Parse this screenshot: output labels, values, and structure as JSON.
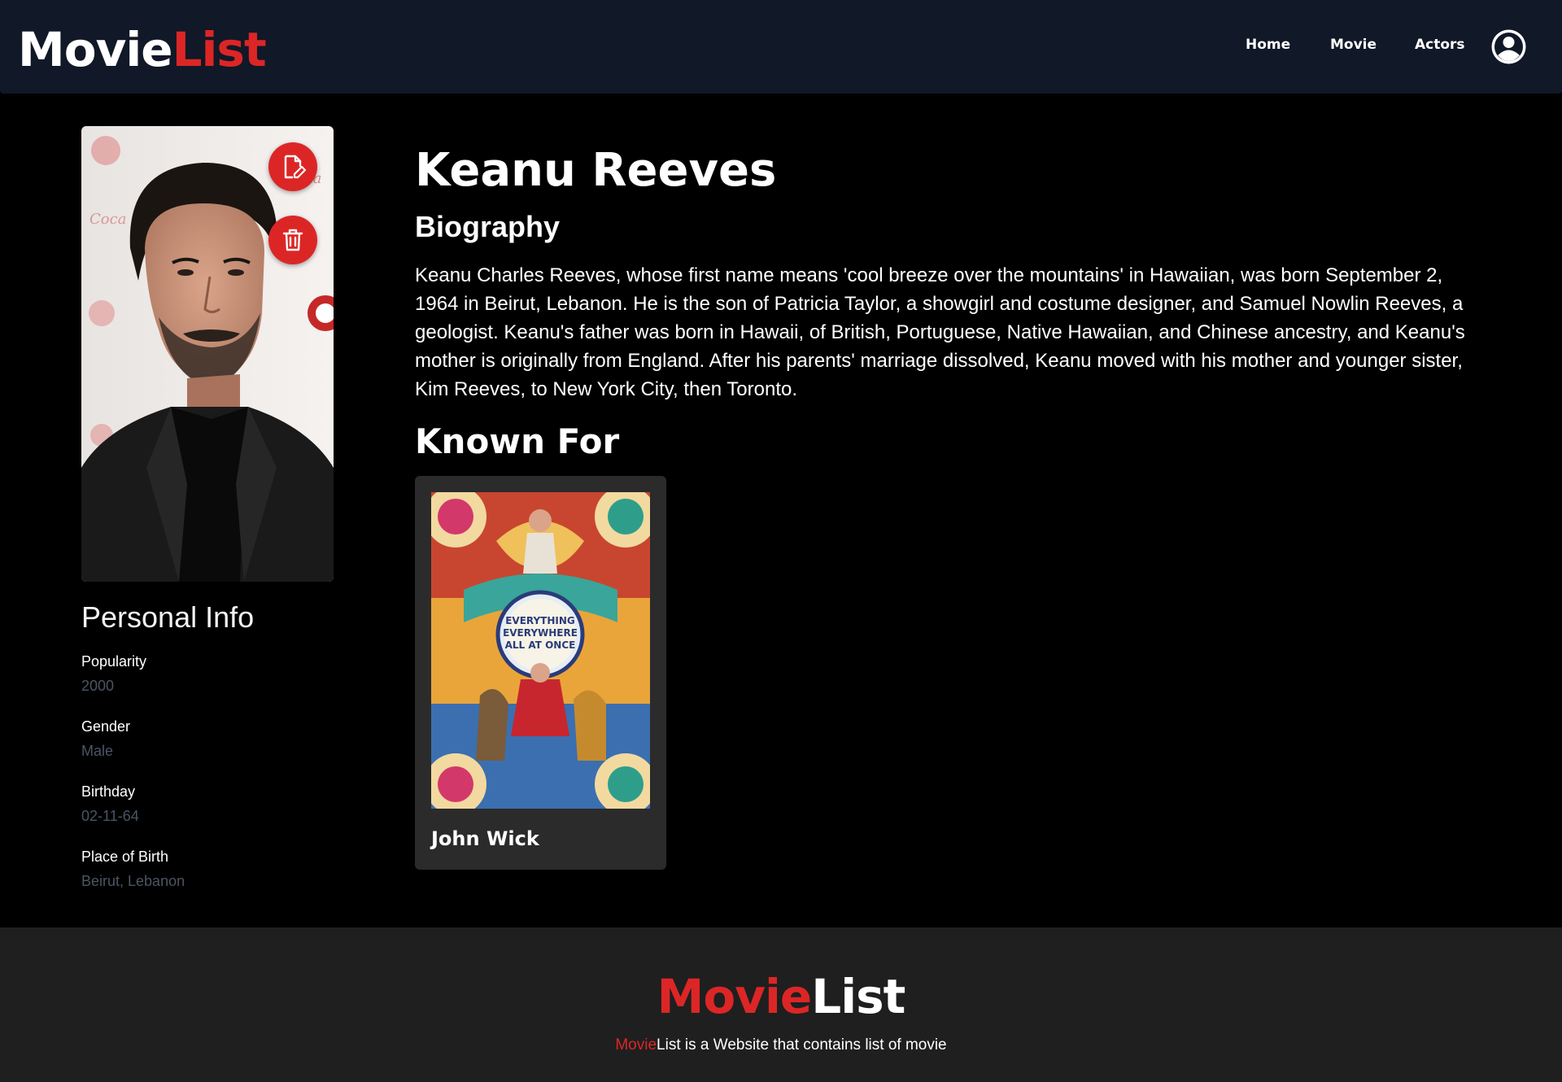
{
  "header": {
    "logo_part1": "Movie",
    "logo_part2": "List",
    "nav": [
      {
        "label": "Home"
      },
      {
        "label": "Movie"
      },
      {
        "label": "Actors"
      }
    ],
    "account_icon": "user-circle-icon"
  },
  "profile": {
    "photo_alt": "Keanu Reeves",
    "actions": [
      {
        "icon": "edit-document-icon"
      },
      {
        "icon": "trash-icon"
      }
    ]
  },
  "personal_info": {
    "title": "Personal Info",
    "items": [
      {
        "label": "Popularity",
        "value": "2000"
      },
      {
        "label": "Gender",
        "value": "Male"
      },
      {
        "label": "Birthday",
        "value": "02-11-64"
      },
      {
        "label": "Place of Birth",
        "value": "Beirut, Lebanon"
      }
    ]
  },
  "actor": {
    "name": "Keanu Reeves",
    "biography_title": "Biography",
    "biography": "Keanu Charles Reeves, whose first name means 'cool breeze over the mountains' in Hawaiian, was born September 2, 1964 in Beirut, Lebanon. He is the son of Patricia Taylor, a showgirl and costume designer, and Samuel Nowlin Reeves, a geologist. Keanu's father was born in Hawaii, of British, Portuguese, Native Hawaiian, and Chinese ancestry, and Keanu's mother is originally from England. After his parents' marriage dissolved, Keanu moved with his mother and younger sister, Kim Reeves, to New York City, then Toronto."
  },
  "known_for": {
    "title": "Known For",
    "movies": [
      {
        "title": "John Wick",
        "poster_text_lines": [
          "EVERYTHING",
          "EVERYWHERE",
          "ALL AT ONCE"
        ]
      }
    ]
  },
  "footer": {
    "logo_part1": "Movie",
    "logo_part2": "List",
    "tagline_brand": "Movie",
    "tagline_brand2": "List",
    "tagline_rest": " is a Website that contains list of movie"
  },
  "colors": {
    "accent": "#dc2626",
    "header_bg": "#111827",
    "footer_bg": "#1f1f1f",
    "card_bg": "#2b2b2b",
    "muted_text": "#4b5563"
  }
}
